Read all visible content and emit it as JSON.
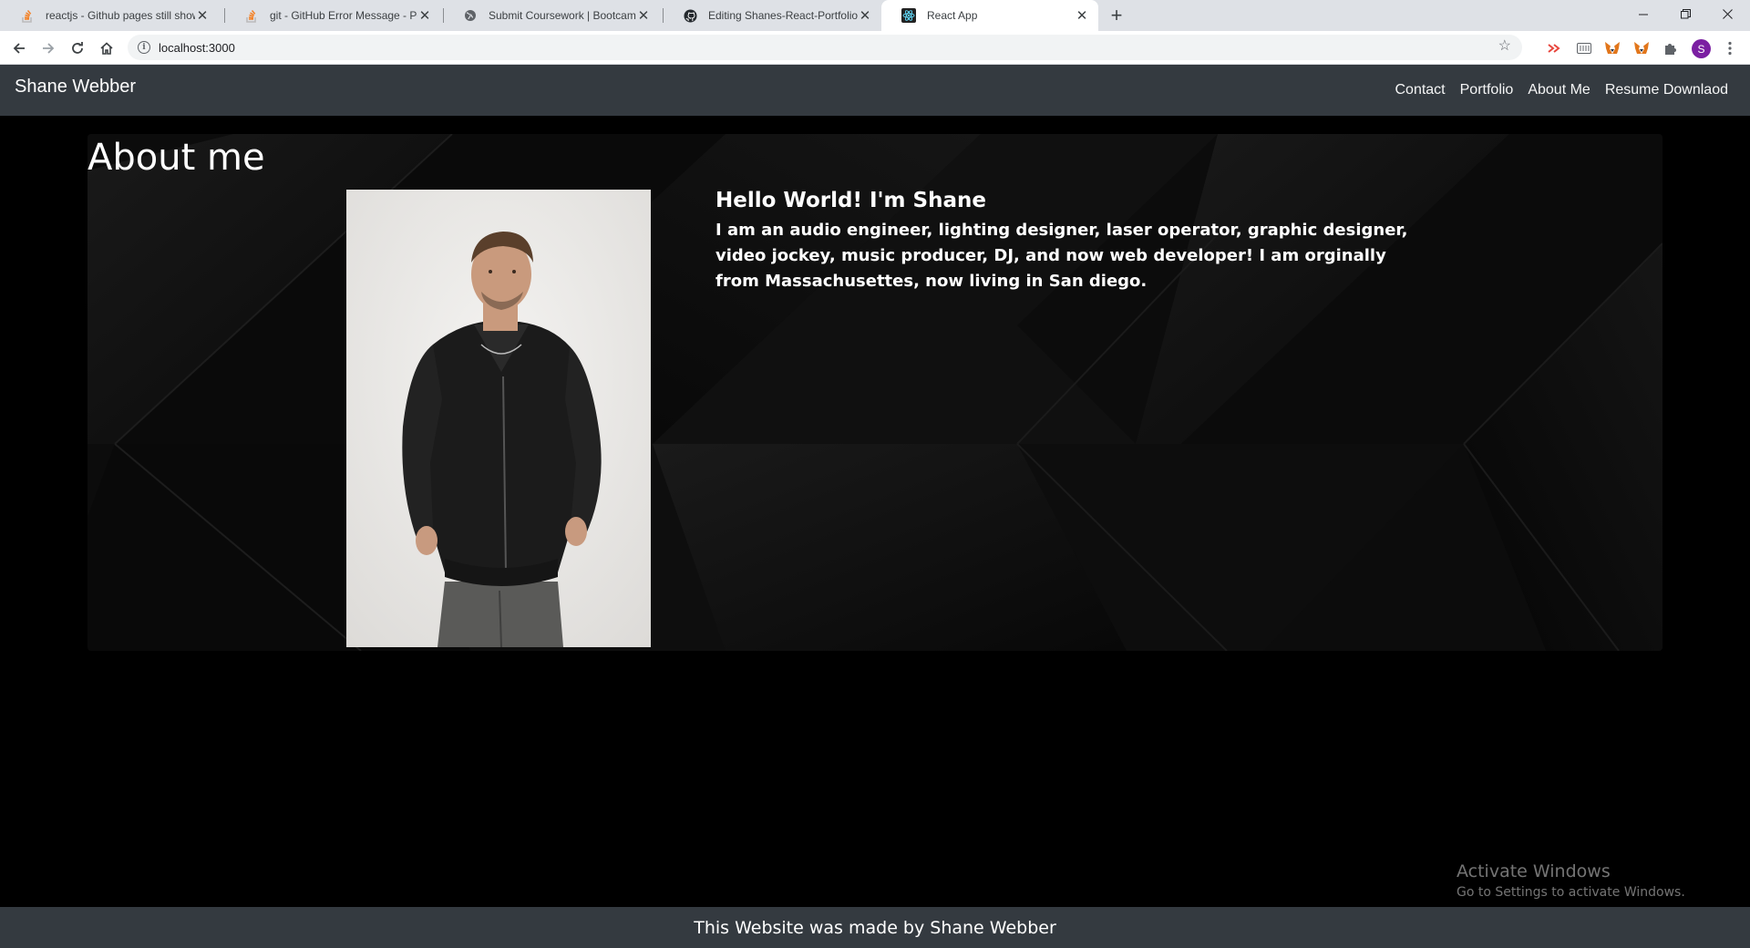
{
  "browser": {
    "tabs": [
      {
        "title": "reactjs - Github pages still shows",
        "icon": "stackoverflow-icon",
        "active": false
      },
      {
        "title": "git - GitHub Error Message - Perm",
        "icon": "stackoverflow-icon",
        "active": false
      },
      {
        "title": "Submit Coursework | Bootcamp S",
        "icon": "globe-icon",
        "active": false
      },
      {
        "title": "Editing Shanes-React-Portfolio/R",
        "icon": "github-icon",
        "active": false
      },
      {
        "title": "React App",
        "icon": "react-icon",
        "active": true
      }
    ],
    "url": "localhost:3000",
    "profile_initial": "S",
    "profile_color": "#7b1fa2"
  },
  "nav": {
    "brand": "Shane Webber",
    "links": [
      "Contact",
      "Portfolio",
      "About Me",
      "Resume Downlaod"
    ]
  },
  "about": {
    "heading": "About me",
    "greeting": "Hello World! I'm Shane",
    "bio": "I am an audio engineer, lighting designer, laser operator, graphic designer, video jockey, music producer, DJ, and now web developer! I am orginally from Massachusettes, now living in San diego."
  },
  "watermark": {
    "line1": "Activate Windows",
    "line2": "Go to Settings to activate Windows."
  },
  "footer": {
    "text": "This Website was made by Shane Webber"
  },
  "colors": {
    "navbar": "#343a40",
    "page_bg": "#000000"
  }
}
